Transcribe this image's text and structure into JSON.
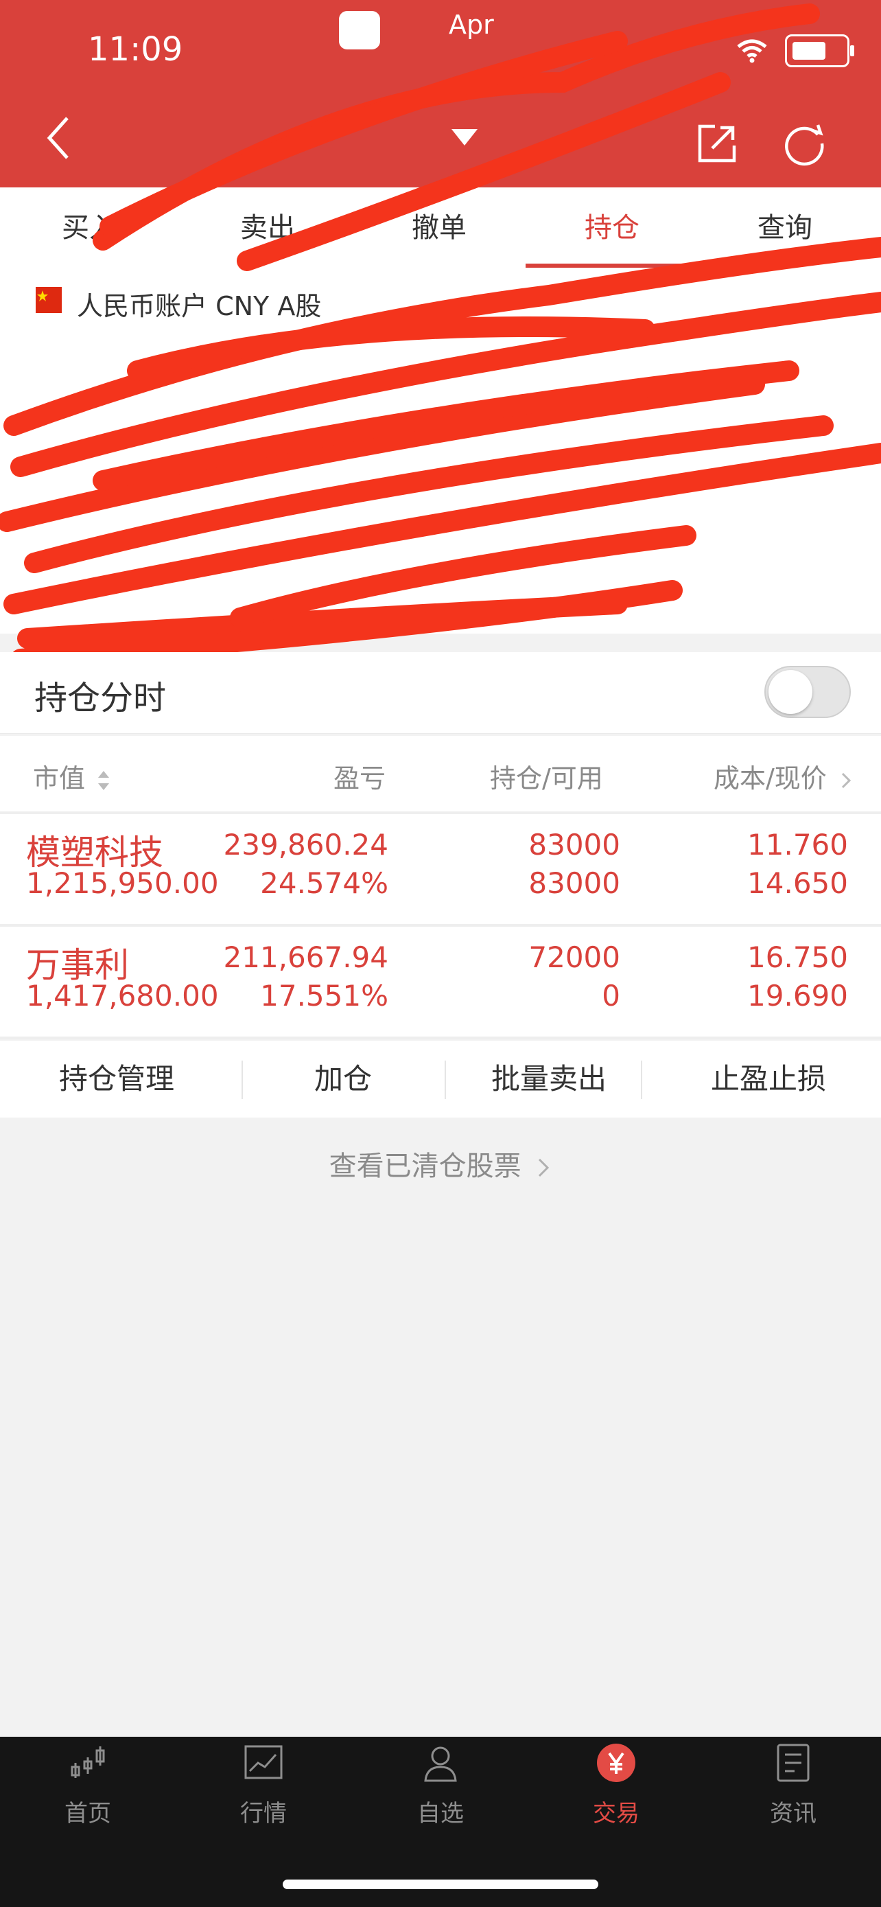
{
  "status_bar": {
    "time": "11:09",
    "app_label": "Apr"
  },
  "tabs": [
    {
      "label": "买入"
    },
    {
      "label": "卖出"
    },
    {
      "label": "撤单"
    },
    {
      "label": "持仓"
    },
    {
      "label": "查询"
    }
  ],
  "account": {
    "label": "人民币账户 CNY A股"
  },
  "timeline": {
    "label": "持仓分时"
  },
  "columns": {
    "market_value": "市值",
    "pnl": "盈亏",
    "position": "持仓/可用",
    "cost_price": "成本/现价"
  },
  "holdings": [
    {
      "name": "模塑科技",
      "market_value": "1,215,950.00",
      "pnl": "239,860.24",
      "pnl_pct": "24.574%",
      "position": "83000",
      "available": "83000",
      "cost": "11.760",
      "price": "14.650"
    },
    {
      "name": "万事利",
      "market_value": "1,417,680.00",
      "pnl": "211,667.94",
      "pnl_pct": "17.551%",
      "position": "72000",
      "available": "0",
      "cost": "16.750",
      "price": "19.690"
    }
  ],
  "actions": [
    {
      "label": "持仓管理"
    },
    {
      "label": "加仓"
    },
    {
      "label": "批量卖出"
    },
    {
      "label": "止盈止损"
    }
  ],
  "cleared_link": "查看已清仓股票",
  "bottom_nav": [
    {
      "label": "首页",
      "icon": "candlestick-icon"
    },
    {
      "label": "行情",
      "icon": "chart-line-icon"
    },
    {
      "label": "自选",
      "icon": "person-icon"
    },
    {
      "label": "交易",
      "icon": "yen-icon"
    },
    {
      "label": "资讯",
      "icon": "news-icon"
    }
  ],
  "colors": {
    "accent": "#d9413b",
    "nav_bg": "#151515"
  }
}
